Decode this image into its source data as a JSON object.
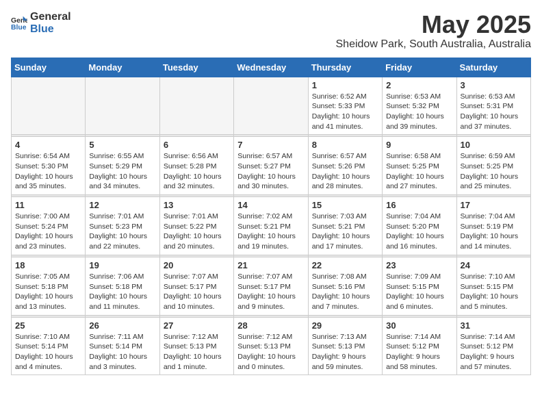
{
  "header": {
    "logo_general": "General",
    "logo_blue": "Blue",
    "month": "May 2025",
    "location": "Sheidow Park, South Australia, Australia"
  },
  "weekdays": [
    "Sunday",
    "Monday",
    "Tuesday",
    "Wednesday",
    "Thursday",
    "Friday",
    "Saturday"
  ],
  "weeks": [
    [
      {
        "day": "",
        "info": ""
      },
      {
        "day": "",
        "info": ""
      },
      {
        "day": "",
        "info": ""
      },
      {
        "day": "",
        "info": ""
      },
      {
        "day": "1",
        "info": "Sunrise: 6:52 AM\nSunset: 5:33 PM\nDaylight: 10 hours and 41 minutes."
      },
      {
        "day": "2",
        "info": "Sunrise: 6:53 AM\nSunset: 5:32 PM\nDaylight: 10 hours and 39 minutes."
      },
      {
        "day": "3",
        "info": "Sunrise: 6:53 AM\nSunset: 5:31 PM\nDaylight: 10 hours and 37 minutes."
      }
    ],
    [
      {
        "day": "4",
        "info": "Sunrise: 6:54 AM\nSunset: 5:30 PM\nDaylight: 10 hours and 35 minutes."
      },
      {
        "day": "5",
        "info": "Sunrise: 6:55 AM\nSunset: 5:29 PM\nDaylight: 10 hours and 34 minutes."
      },
      {
        "day": "6",
        "info": "Sunrise: 6:56 AM\nSunset: 5:28 PM\nDaylight: 10 hours and 32 minutes."
      },
      {
        "day": "7",
        "info": "Sunrise: 6:57 AM\nSunset: 5:27 PM\nDaylight: 10 hours and 30 minutes."
      },
      {
        "day": "8",
        "info": "Sunrise: 6:57 AM\nSunset: 5:26 PM\nDaylight: 10 hours and 28 minutes."
      },
      {
        "day": "9",
        "info": "Sunrise: 6:58 AM\nSunset: 5:25 PM\nDaylight: 10 hours and 27 minutes."
      },
      {
        "day": "10",
        "info": "Sunrise: 6:59 AM\nSunset: 5:25 PM\nDaylight: 10 hours and 25 minutes."
      }
    ],
    [
      {
        "day": "11",
        "info": "Sunrise: 7:00 AM\nSunset: 5:24 PM\nDaylight: 10 hours and 23 minutes."
      },
      {
        "day": "12",
        "info": "Sunrise: 7:01 AM\nSunset: 5:23 PM\nDaylight: 10 hours and 22 minutes."
      },
      {
        "day": "13",
        "info": "Sunrise: 7:01 AM\nSunset: 5:22 PM\nDaylight: 10 hours and 20 minutes."
      },
      {
        "day": "14",
        "info": "Sunrise: 7:02 AM\nSunset: 5:21 PM\nDaylight: 10 hours and 19 minutes."
      },
      {
        "day": "15",
        "info": "Sunrise: 7:03 AM\nSunset: 5:21 PM\nDaylight: 10 hours and 17 minutes."
      },
      {
        "day": "16",
        "info": "Sunrise: 7:04 AM\nSunset: 5:20 PM\nDaylight: 10 hours and 16 minutes."
      },
      {
        "day": "17",
        "info": "Sunrise: 7:04 AM\nSunset: 5:19 PM\nDaylight: 10 hours and 14 minutes."
      }
    ],
    [
      {
        "day": "18",
        "info": "Sunrise: 7:05 AM\nSunset: 5:18 PM\nDaylight: 10 hours and 13 minutes."
      },
      {
        "day": "19",
        "info": "Sunrise: 7:06 AM\nSunset: 5:18 PM\nDaylight: 10 hours and 11 minutes."
      },
      {
        "day": "20",
        "info": "Sunrise: 7:07 AM\nSunset: 5:17 PM\nDaylight: 10 hours and 10 minutes."
      },
      {
        "day": "21",
        "info": "Sunrise: 7:07 AM\nSunset: 5:17 PM\nDaylight: 10 hours and 9 minutes."
      },
      {
        "day": "22",
        "info": "Sunrise: 7:08 AM\nSunset: 5:16 PM\nDaylight: 10 hours and 7 minutes."
      },
      {
        "day": "23",
        "info": "Sunrise: 7:09 AM\nSunset: 5:15 PM\nDaylight: 10 hours and 6 minutes."
      },
      {
        "day": "24",
        "info": "Sunrise: 7:10 AM\nSunset: 5:15 PM\nDaylight: 10 hours and 5 minutes."
      }
    ],
    [
      {
        "day": "25",
        "info": "Sunrise: 7:10 AM\nSunset: 5:14 PM\nDaylight: 10 hours and 4 minutes."
      },
      {
        "day": "26",
        "info": "Sunrise: 7:11 AM\nSunset: 5:14 PM\nDaylight: 10 hours and 3 minutes."
      },
      {
        "day": "27",
        "info": "Sunrise: 7:12 AM\nSunset: 5:13 PM\nDaylight: 10 hours and 1 minute."
      },
      {
        "day": "28",
        "info": "Sunrise: 7:12 AM\nSunset: 5:13 PM\nDaylight: 10 hours and 0 minutes."
      },
      {
        "day": "29",
        "info": "Sunrise: 7:13 AM\nSunset: 5:13 PM\nDaylight: 9 hours and 59 minutes."
      },
      {
        "day": "30",
        "info": "Sunrise: 7:14 AM\nSunset: 5:12 PM\nDaylight: 9 hours and 58 minutes."
      },
      {
        "day": "31",
        "info": "Sunrise: 7:14 AM\nSunset: 5:12 PM\nDaylight: 9 hours and 57 minutes."
      }
    ]
  ]
}
